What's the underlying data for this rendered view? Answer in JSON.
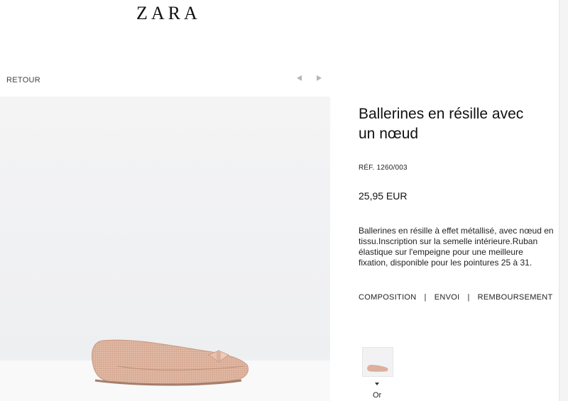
{
  "header": {
    "brand": "ZARA"
  },
  "nav": {
    "back_label": "RETOUR",
    "prev_icon": "triangle-left",
    "next_icon": "triangle-right"
  },
  "product": {
    "title": "Ballerines en résille avec un nœud",
    "ref": "RÉF. 1260/003",
    "price": "25,95 EUR",
    "description": "Ballerines en résille à effet métallisé, avec nœud en tissu.Inscription sur la semelle intérieure.Ruban élastique sur l'empeigne pour une meilleure fixation, disponible pour les pointures 25 à 31.",
    "tabs": [
      {
        "label": "COMPOSITION"
      },
      {
        "label": "ENVOI"
      },
      {
        "label": "REMBOURSEMENT"
      }
    ],
    "tab_separator": "|",
    "colors": [
      {
        "label": "Or",
        "hex": "#d9b3a0"
      }
    ]
  },
  "theme": {
    "accent": "#111111",
    "image_bg": "#f0f1f3",
    "shoe_color": "#d9ae98"
  }
}
